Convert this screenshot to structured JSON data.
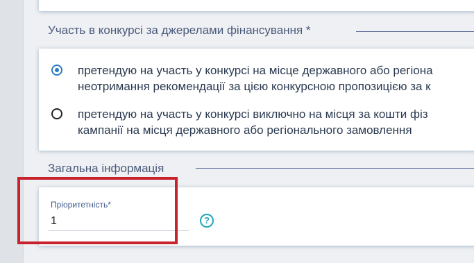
{
  "funding_section": {
    "title": "Участь в конкурсі за джерелами фінансування *",
    "options": [
      {
        "line1": "претендую на участь у конкурсі на місце державного або регіона",
        "line2": "неотримання рекомендації за цією конкурсною пропозицією за к",
        "selected": true
      },
      {
        "line1": "претендую на участь у конкурсі виключно на місця за кошти фіз",
        "line2": "кампанії на місця державного або регіонального замовлення",
        "selected": false
      }
    ]
  },
  "general_section": {
    "title": "Загальна інформація",
    "priority_label": "Пріоритетність*",
    "priority_value": "1",
    "help_glyph": "?"
  },
  "colors": {
    "highlight": "#c8232c",
    "radio_selected": "#2b7bc5",
    "help_icon": "#1fa8b5"
  }
}
